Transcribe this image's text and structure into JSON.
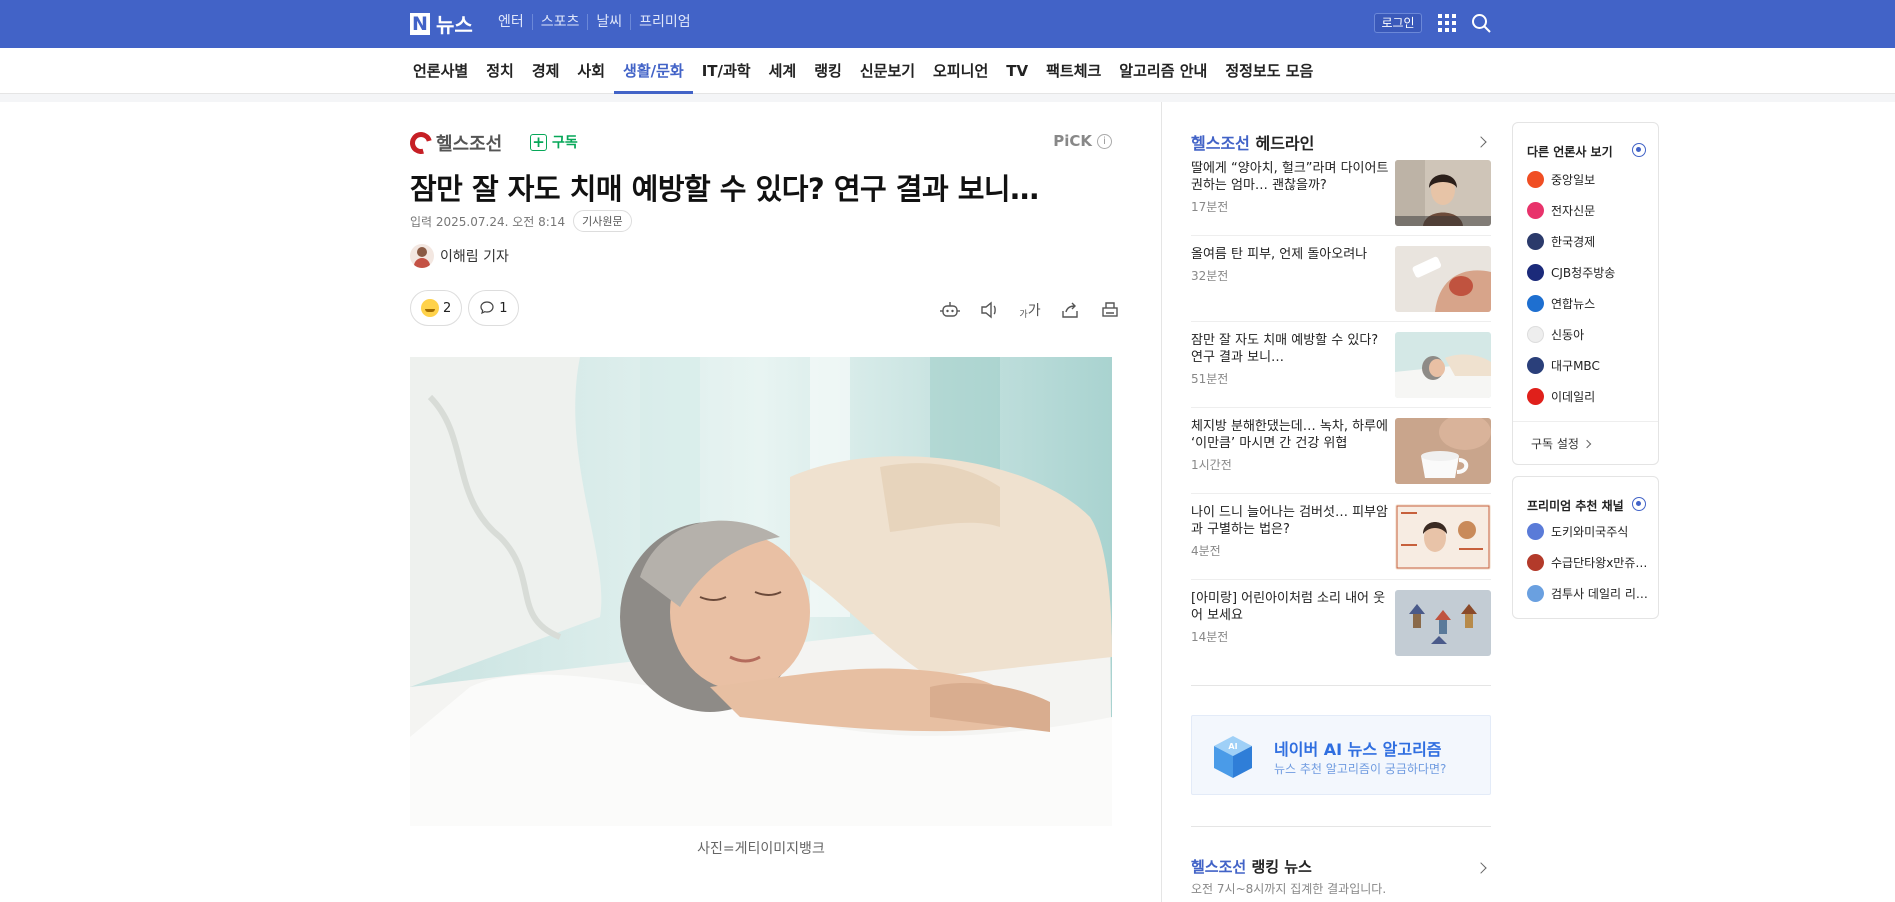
{
  "topbar": {
    "logo_letter": "N",
    "logo_text": "뉴스",
    "nav": [
      "엔터",
      "스포츠",
      "날씨",
      "프리미엄"
    ],
    "login_label": "로그인"
  },
  "section_nav": {
    "items": [
      "언론사별",
      "정치",
      "경제",
      "사회",
      "생활/문화",
      "IT/과학",
      "세계",
      "랭킹",
      "신문보기",
      "오피니언",
      "TV",
      "팩트체크",
      "알고리즘 안내",
      "정정보도 모음"
    ],
    "active": "생활/문화"
  },
  "article": {
    "press_name": "헬스조선",
    "subscribe_label": "구독",
    "pick_label": "PiCK",
    "pick_info": "i",
    "headline": "잠만 잘 자도 치매 예방할 수 있다? 연구 결과 보니…",
    "date": "입력 2025.07.24. 오전 8:14",
    "original_label": "기사원문",
    "reporter": "이해림 기자",
    "reaction_count": "2",
    "comment_count": "1",
    "font_tool_label": "가",
    "font_tool_small": "가",
    "caption": "사진=게티이미지뱅크"
  },
  "sidebar": {
    "headline_press": "헬스조선",
    "headline_label": "헤드라인",
    "items": [
      {
        "title": "딸에게 “양아치, 헐크”라며 다이어트 권하는 엄마… 괜찮을까?",
        "time": "17분전"
      },
      {
        "title": "올여름 탄 피부, 언제 돌아오려나",
        "time": "32분전"
      },
      {
        "title": "잠만 잘 자도 치매 예방할 수 있다? 연구 결과 보니…",
        "time": "51분전"
      },
      {
        "title": "체지방 분해한댔는데… 녹차, 하루에 ‘이만큼’ 마시면 간 건강 위협",
        "time": "1시간전"
      },
      {
        "title": "나이 드니 늘어나는 검버섯… 피부암과 구별하는 법은?",
        "time": "4분전"
      },
      {
        "title": "[아미랑] 어린아이처럼 소리 내어 웃어 보세요",
        "time": "14분전"
      }
    ],
    "ai_title": "네이버 AI 뉴스 알고리즘",
    "ai_sub": "뉴스 추천 알고리즘이 궁금하다면?",
    "ai_cube_label": "AI",
    "ranking_press": "헬스조선",
    "ranking_label": "랭킹 뉴스",
    "ranking_sub": "오전 7시~8시까지 집계한 결과입니다."
  },
  "other_press": {
    "title": "다른 언론사 보기",
    "items": [
      {
        "name": "중앙일보",
        "color": "#f04e23"
      },
      {
        "name": "전자신문",
        "color": "#e8336b"
      },
      {
        "name": "한국경제",
        "color": "#2b3a6b"
      },
      {
        "name": "CJB청주방송",
        "color": "#1b2a7a"
      },
      {
        "name": "연합뉴스",
        "color": "#1e6fd0"
      },
      {
        "name": "신동아",
        "color": "#dddddd"
      },
      {
        "name": "대구MBC",
        "color": "#2a3f7a"
      },
      {
        "name": "이데일리",
        "color": "#e0201b"
      }
    ],
    "setting_label": "구독 설정"
  },
  "premium": {
    "title": "프리미엄 추천 채널",
    "items": [
      {
        "name": "도키와미국주식",
        "color": "#5a7bd8"
      },
      {
        "name": "수급단타왕x만쥬…",
        "color": "#b33a2a"
      },
      {
        "name": "검투사 데일리 리…",
        "color": "#6aa0e0"
      }
    ]
  }
}
